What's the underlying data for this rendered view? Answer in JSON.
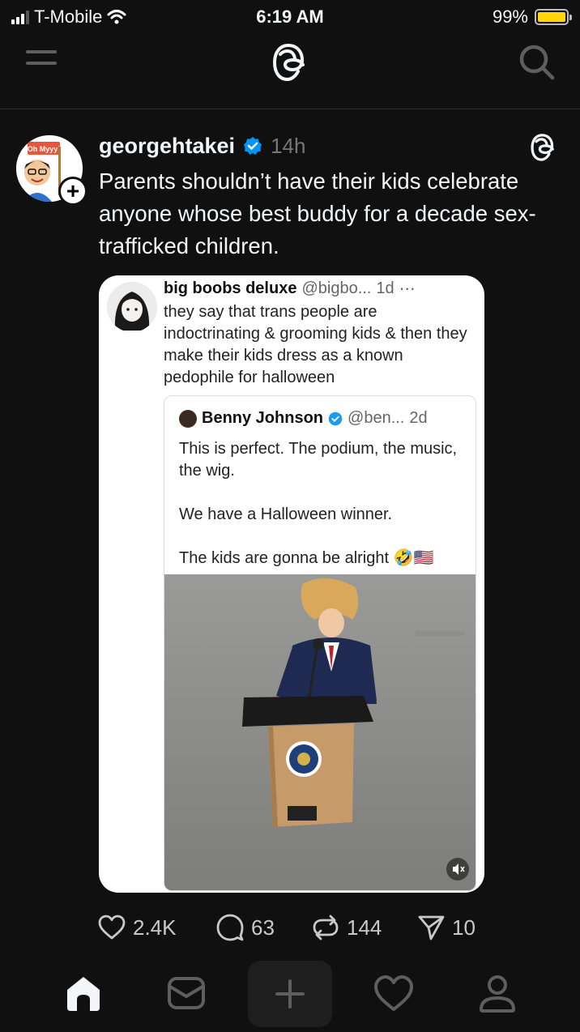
{
  "status_bar": {
    "carrier": "T-Mobile",
    "time": "6:19 AM",
    "battery": "99%",
    "battery_color": "#ffd60a"
  },
  "top_nav": {
    "menu_icon": "hamburger-menu-icon",
    "logo_icon": "threads-logo-icon",
    "search_icon": "search-icon"
  },
  "post": {
    "avatar_sign_text": "Oh Myyy!",
    "username": "georgehtakei",
    "verified": true,
    "time_ago": "14h",
    "text": "Parents shouldn’t have their kids celebrate anyone whose best buddy for a decade sex-trafficked children.",
    "embed": {
      "author": "big boobs deluxe",
      "handle": "@bigbo...",
      "time": "1d",
      "text": "they say that trans people are indoctrinating & grooming kids & then they make their kids dress as a known pedophile for halloween",
      "quoted": {
        "author": "Benny Johnson",
        "handle": "@ben...",
        "time": "2d",
        "text": "This is perfect. The podium, the music, the wig.\n\nWe have a Halloween winner.\n\nThe kids are gonna be alright 🤣🇺🇸"
      }
    },
    "stats": {
      "likes": "2.4K",
      "replies": "63",
      "reposts": "144",
      "shares": "10"
    }
  },
  "bottom_nav": {
    "items": [
      "home-icon",
      "inbox-icon",
      "create-icon",
      "activity-heart-icon",
      "profile-icon"
    ]
  },
  "colors": {
    "background": "#101010",
    "verified_blue": "#0095f6"
  }
}
